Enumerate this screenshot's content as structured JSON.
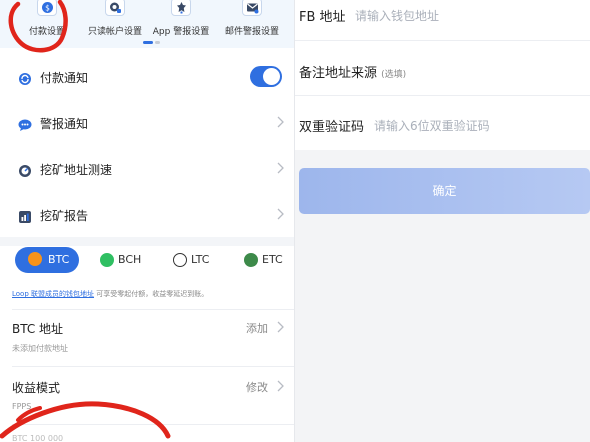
{
  "top_tabs": [
    {
      "label": "付款设置",
      "icon": "payment-settings-icon"
    },
    {
      "label": "只读帐户设置",
      "icon": "readonly-account-icon"
    },
    {
      "label": "App 警报设置",
      "icon": "app-alert-icon"
    },
    {
      "label": "邮件警报设置",
      "icon": "email-alert-icon"
    }
  ],
  "menu": {
    "payment_notice": "付款通知",
    "alert_notice": "警报通知",
    "speed_test": "挖矿地址测速",
    "report": "挖矿报告",
    "payment_notice_enabled": true
  },
  "coins": {
    "btc": "BTC",
    "bch": "BCH",
    "ltc": "LTC",
    "etc": "ETC",
    "selected": "BTC"
  },
  "hint": {
    "link": "Loop 联盟成员的钱包地址",
    "text": "可享受零起付额，收益零延迟到账。"
  },
  "btc_address": {
    "label": "BTC 地址",
    "action": "添加",
    "sub": "未添加付款地址"
  },
  "income_mode": {
    "label": "收益模式",
    "action": "修改",
    "sub": "FPPS"
  },
  "bottom_partial": "BTC 100 000",
  "form": {
    "fb_label": "FB 地址",
    "fb_placeholder": "请输入钱包地址",
    "note_label": "备注地址来源",
    "note_optional": "(选填)",
    "twofa_label": "双重验证码",
    "twofa_placeholder": "请输入6位双重验证码",
    "confirm": "确定"
  },
  "colors": {
    "accent": "#2f6fe0",
    "annotation": "#e0251b"
  }
}
